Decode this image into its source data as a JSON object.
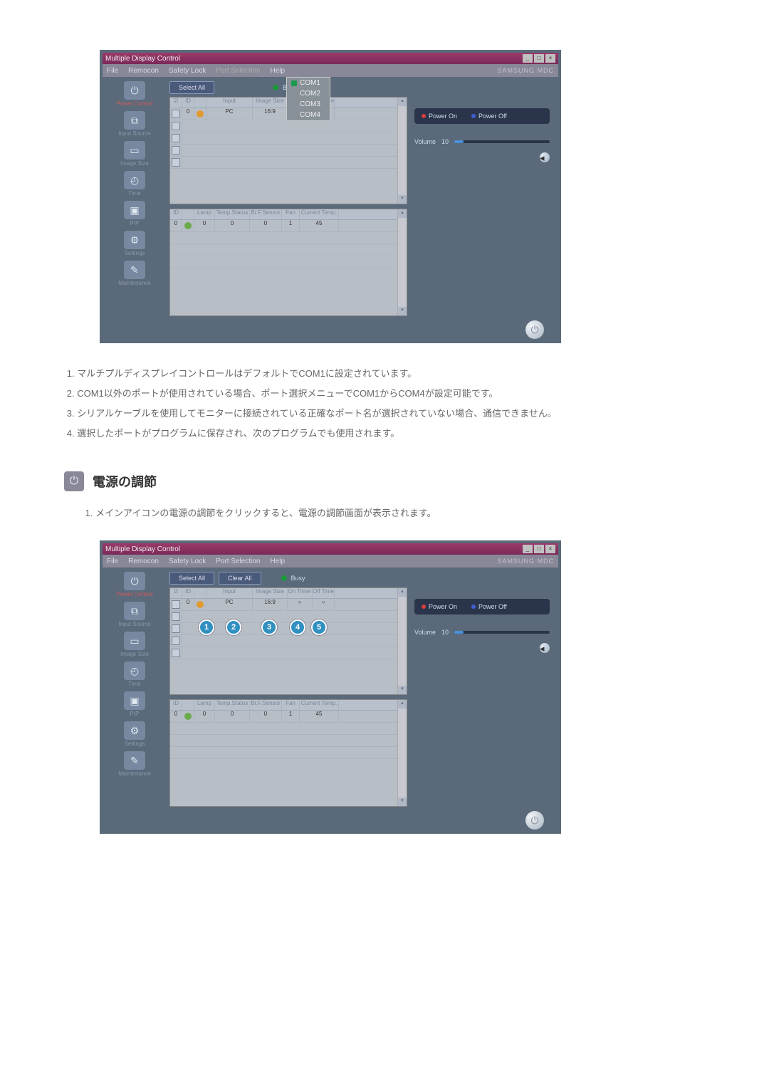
{
  "app": {
    "title": "Multiple Display Control",
    "brand": "SAMSUNG MDC",
    "winbtns": [
      "_",
      "□",
      "×"
    ],
    "menu": {
      "file": "File",
      "remocon": "Remocon",
      "safety": "Safety Lock",
      "port": "Port Selection",
      "help": "Help"
    },
    "port_dropdown": [
      "COM1",
      "COM2",
      "COM3",
      "COM4"
    ]
  },
  "toolbar": {
    "select_all": "Select All",
    "clear_all": "Clear All",
    "busy": "Busy"
  },
  "sidebar": [
    {
      "glyph": "⏻",
      "label": "Power Control",
      "active": true
    },
    {
      "glyph": "⧉",
      "label": "Input Source"
    },
    {
      "glyph": "▭",
      "label": "Image Size"
    },
    {
      "glyph": "◴",
      "label": "Time"
    },
    {
      "glyph": "▣",
      "label": "PIP"
    },
    {
      "glyph": "⚙",
      "label": "Settings"
    },
    {
      "glyph": "✎",
      "label": "Maintenance"
    }
  ],
  "grid1_head": [
    "☑",
    "ID",
    "",
    "Input",
    "Image Size",
    "On Timer",
    "Off Timer"
  ],
  "grid1_row": {
    "id": "0",
    "input": "PC",
    "size": "16:9",
    "on": "○",
    "off": "○"
  },
  "grid2_head": [
    "ID",
    "",
    "Lamp",
    "Temp.Status",
    "Br.F.Sensor",
    "Fan",
    "Current Temp."
  ],
  "grid2_row": {
    "id": "0",
    "lamp": "0",
    "ts": "0",
    "bf": "0",
    "fan": "1",
    "ct": "45"
  },
  "right": {
    "power_on": "Power On",
    "power_off": "Power Off",
    "volume_label": "Volume",
    "volume_value": "10"
  },
  "callouts": [
    "1",
    "2",
    "3",
    "4",
    "5"
  ],
  "notes": [
    "マルチプルディスプレイコントロールはデフォルトでCOM1に設定されています。",
    "COM1以外のポートが使用されている場合、ポート選択メニューでCOM1からCOM4が設定可能です。",
    "シリアルケーブルを使用してモニターに接続されている正確なポート名が選択されていない場合、通信できません。",
    "選択したポートがプログラムに保存され、次のプログラムでも使用されます。"
  ],
  "heading": "電源の調節",
  "subnote": "メインアイコンの電源の調節をクリックすると、電源の調節画面が表示されます。"
}
